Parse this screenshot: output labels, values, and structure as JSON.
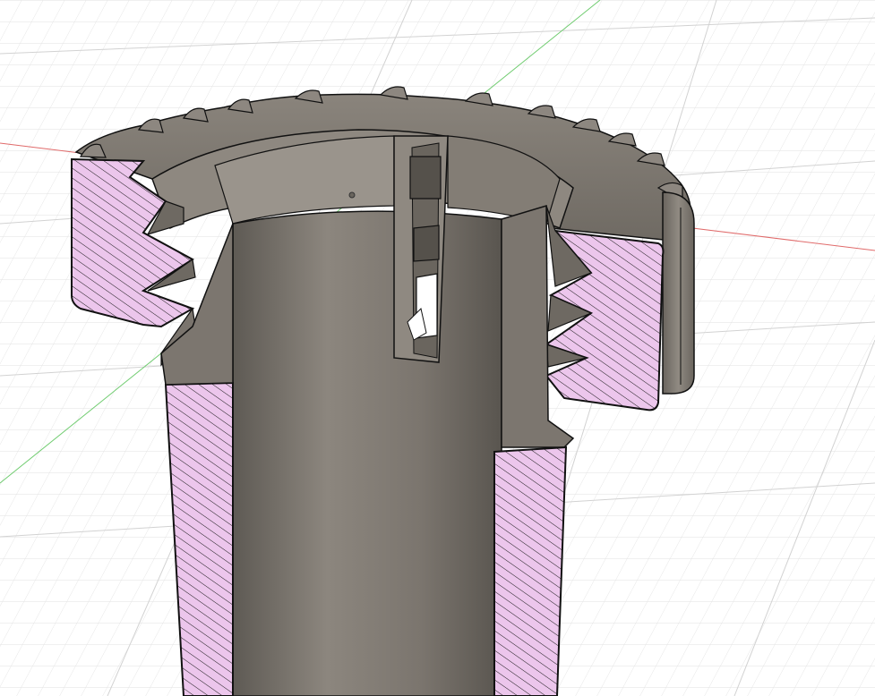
{
  "scene": {
    "kind": "3d-cad-section-view",
    "subject": "threaded-knurled-bushing-cutaway",
    "background_color": "#ffffff",
    "grid": {
      "visible": true,
      "minor_color": "#e3e3e3",
      "major_color": "#cfcfcf"
    },
    "axes": {
      "x_axis_color": "#e06060",
      "y_axis_color": "#66cc66"
    },
    "body_color": "#78726a",
    "section_fill_color": "#ecc6ec",
    "section_hatch_color": "#1a1a1a",
    "edge_color": "#111111"
  }
}
